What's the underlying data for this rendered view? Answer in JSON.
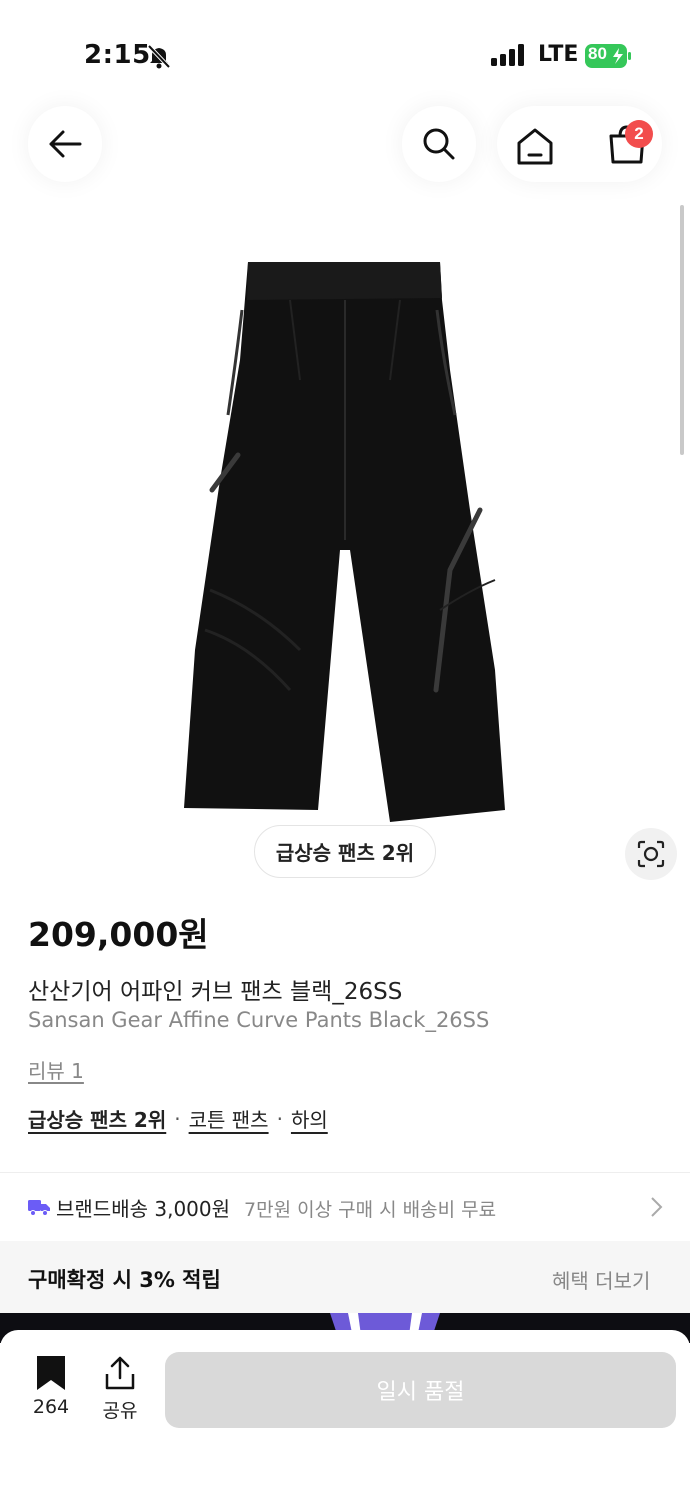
{
  "status_bar": {
    "time": "2:15",
    "network": "LTE",
    "battery": "80"
  },
  "header": {
    "cart_count": "2"
  },
  "product": {
    "rank_chip": "급상승 팬츠 2위",
    "price": "209,000원",
    "name_ko": "산산기어 어파인 커브 팬츠 블랙_26SS",
    "name_en": "Sansan Gear Affine Curve Pants Black_26SS",
    "review": "리뷰 1",
    "categories": [
      "급상승 팬츠 2위",
      "코튼 팬츠",
      "하의"
    ],
    "category_separator": "·"
  },
  "shipping": {
    "label": "브랜드배송 3,000원",
    "note": "7만원 이상 구매 시 배송비 무료"
  },
  "benefit": {
    "label": "구매확정 시 3% 적립",
    "more": "혜택 더보기"
  },
  "bottom_bar": {
    "bookmark_count": "264",
    "share_label": "공유",
    "soldout_label": "일시 품절"
  },
  "colors": {
    "badge": "#f24d4d",
    "battery_green": "#35c759",
    "shipping_icon": "#6b5cf6",
    "soldout_bg": "#d9d9d9"
  }
}
